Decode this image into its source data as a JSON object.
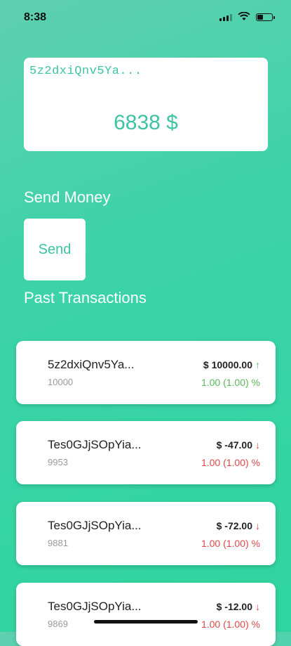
{
  "status_bar": {
    "time": "8:38",
    "icons": [
      "signal-icon",
      "wifi-icon",
      "battery-icon"
    ]
  },
  "wallet": {
    "address": "5z2dxiQnv5Ya...",
    "balance": "6838 $"
  },
  "send_section": {
    "title": "Send Money",
    "button_label": "Send"
  },
  "transactions_section": {
    "title": "Past Transactions"
  },
  "transactions": [
    {
      "name": "5z2dxiQnv5Ya...",
      "sub": "10000",
      "amount": "$ 10000.00",
      "direction": "up",
      "change": "1.00 (1.00) %"
    },
    {
      "name": "Tes0GJjSOpYia...",
      "sub": "9953",
      "amount": "$ -47.00",
      "direction": "down",
      "change": "1.00 (1.00) %"
    },
    {
      "name": "Tes0GJjSOpYia...",
      "sub": "9881",
      "amount": "$ -72.00",
      "direction": "down",
      "change": "1.00 (1.00) %"
    },
    {
      "name": "Tes0GJjSOpYia...",
      "sub": "9869",
      "amount": "$ -12.00",
      "direction": "down",
      "change": "1.00 (1.00) %"
    }
  ],
  "colors": {
    "accent": "#3dc3a4",
    "positive": "#5cb85c",
    "negative": "#e04848"
  }
}
